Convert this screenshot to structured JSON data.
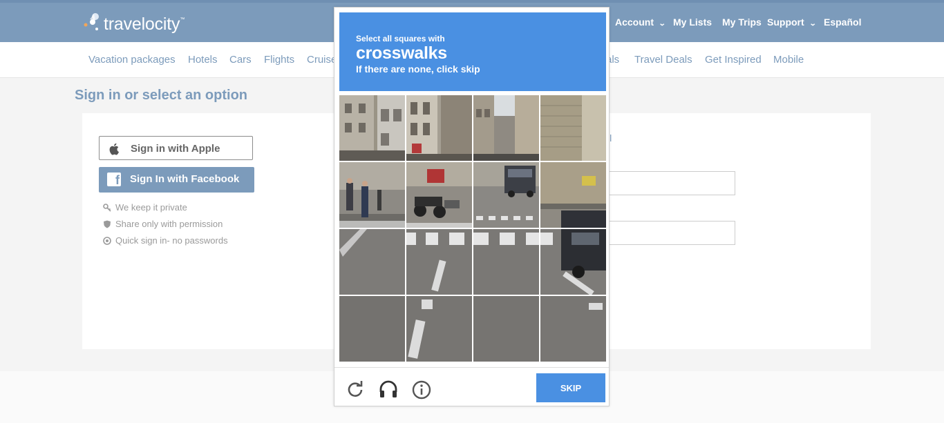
{
  "header": {
    "logo_text": "travelocity",
    "logo_mark": "™",
    "nav": [
      {
        "label": "Account",
        "dropdown": true
      },
      {
        "label": "My Lists",
        "dropdown": false
      },
      {
        "label": "My Trips",
        "dropdown": false
      },
      {
        "label": "Support",
        "dropdown": true
      },
      {
        "label": "Español",
        "dropdown": false
      }
    ]
  },
  "subnav": {
    "left_items": [
      "Vacation packages",
      "Hotels",
      "Cars",
      "Flights",
      "Cruise"
    ],
    "right_items": [
      "als",
      "Travel Deals",
      "Get Inspired",
      "Mobile"
    ]
  },
  "page": {
    "title": "Sign in or select an option",
    "apple_button": "Sign in with Apple",
    "facebook_button": "Sign In with Facebook",
    "perks": [
      {
        "icon": "key-icon",
        "text": "We keep it private"
      },
      {
        "icon": "shield-icon",
        "text": "Share only with permission"
      },
      {
        "icon": "target-icon",
        "text": "Quick sign in- no passwords"
      }
    ],
    "email_link_fragment": "il"
  },
  "captcha": {
    "instruction": "Select all squares with",
    "target": "crosswalks",
    "skip_note": "If there are none, click skip",
    "skip_button": "SKIP",
    "footer_icons": [
      "refresh-icon",
      "headphones-icon",
      "info-icon"
    ],
    "accent_color": "#4a90e2"
  },
  "colors": {
    "brand": "#7c9bbb",
    "captcha_blue": "#4a90e2"
  }
}
